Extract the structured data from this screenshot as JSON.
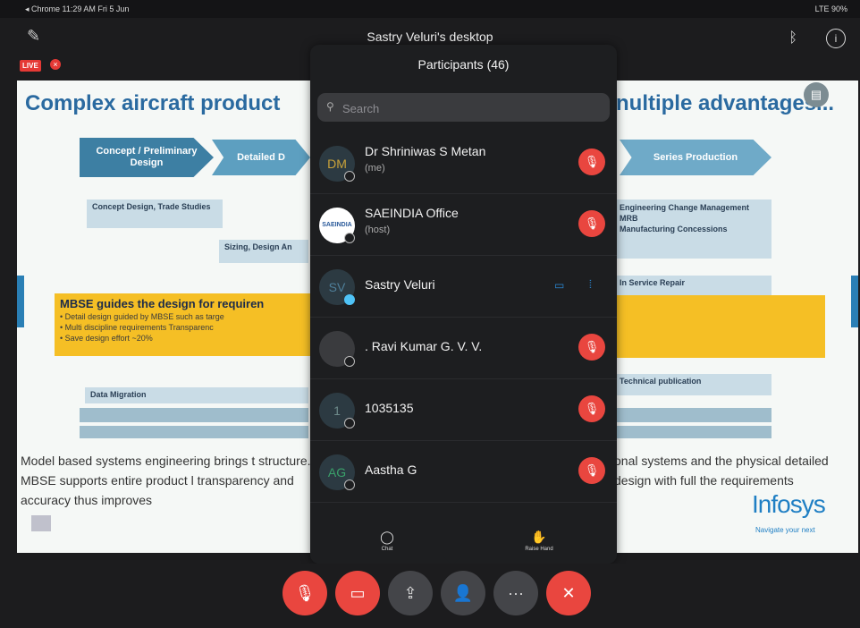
{
  "status_bar": {
    "left": "◂ Chrome  11:29 AM  Fri 5 Jun",
    "right": "LTE 90%"
  },
  "meeting": {
    "host_title": "Sastry Veluri's desktop",
    "live_label": "LIVE"
  },
  "slide": {
    "title_left": "Complex aircraft product",
    "title_right": "nultiple advantages...",
    "chevrons": [
      "Concept / Preliminary Design",
      "Detailed D",
      "Series Production"
    ],
    "boxes_left": [
      "Concept Design, Trade Studies",
      "Sizing, Design An",
      "Data Migration"
    ],
    "boxes_right": [
      "Engineering Change Management\nMRB\nManufacturing Concessions",
      "In Service Repair",
      "Technical publication"
    ],
    "mbse_title": "MBSE guides the design for requiren",
    "mbse_bullets": [
      "Detail design guided by MBSE such as targe",
      "Multi discipline  requirements Transparenc",
      "Save design effort ~20%"
    ],
    "body_left": "Model based systems engineering brings t structure.  MBSE supports entire product l transparency and accuracy thus improves",
    "body_right": "onal systems and the physical detailed design with full the requirements",
    "logo": "Infosys",
    "logo_tagline": "Navigate your next"
  },
  "participants_panel": {
    "title": "Participants (46)",
    "search_placeholder": "Search",
    "participants": [
      {
        "initials": "DM",
        "name": "Dr Shriniwas S Metan",
        "role": "(me)",
        "muted": true
      },
      {
        "initials": "SAEINDIA",
        "name": "SAEINDIA Office",
        "role": "(host)",
        "muted": true
      },
      {
        "initials": "SV",
        "name": "Sastry Veluri",
        "role": "",
        "muted": false
      },
      {
        "initials": "",
        "name": ". Ravi Kumar G. V. V.",
        "role": "",
        "muted": true
      },
      {
        "initials": "1",
        "name": "1035135",
        "role": "",
        "muted": true
      },
      {
        "initials": "AG",
        "name": "Aastha G",
        "role": "",
        "muted": true
      }
    ],
    "footer": {
      "chat": "Chat",
      "raise_hand": "Raise Hand"
    }
  },
  "toolbar": [
    "mic-off",
    "video-off",
    "share",
    "participants",
    "more",
    "leave"
  ],
  "colors": {
    "red": "#e9463f",
    "panel": "#1d1e20",
    "accent_blue": "#2b8bd9"
  }
}
